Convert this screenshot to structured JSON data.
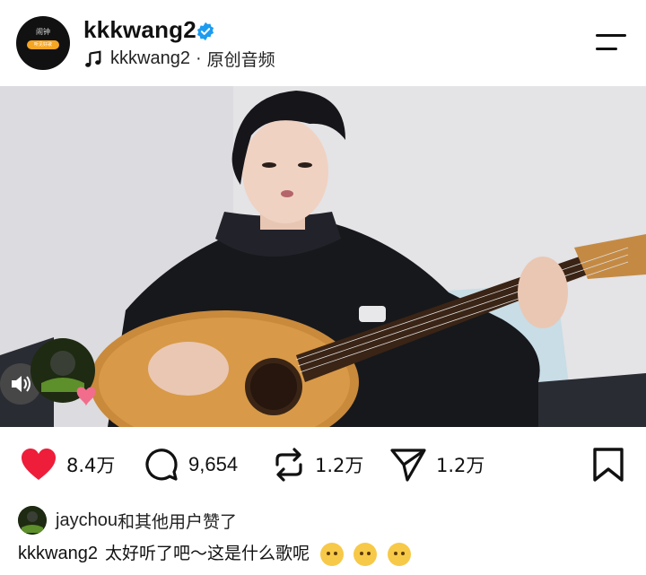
{
  "post": {
    "author": "kkkwang2",
    "avatar_label": "闹钟",
    "avatar_pill": "听见好歌",
    "audio_user": "kkkwang2",
    "audio_separator": "·",
    "audio_type": "原创音频"
  },
  "actions": {
    "likes": "8.4万",
    "comments": "9,654",
    "reposts": "1.2万",
    "shares": "1.2万"
  },
  "liked_by": {
    "user": "jaychou",
    "text": "和其他用户赞了"
  },
  "caption": {
    "user": "kkkwang2",
    "text": "太好听了吧～这是什么歌呢"
  },
  "icons": {
    "verified": "verified-badge-icon",
    "audio": "music-note-icon",
    "menu": "menu-icon",
    "like": "heart-icon",
    "comment": "comment-icon",
    "repost": "repost-icon",
    "share": "send-icon",
    "save": "bookmark-icon",
    "sound": "speaker-icon"
  },
  "colors": {
    "like_red": "#ee1d3a",
    "verified_blue": "#1d9bf0"
  }
}
